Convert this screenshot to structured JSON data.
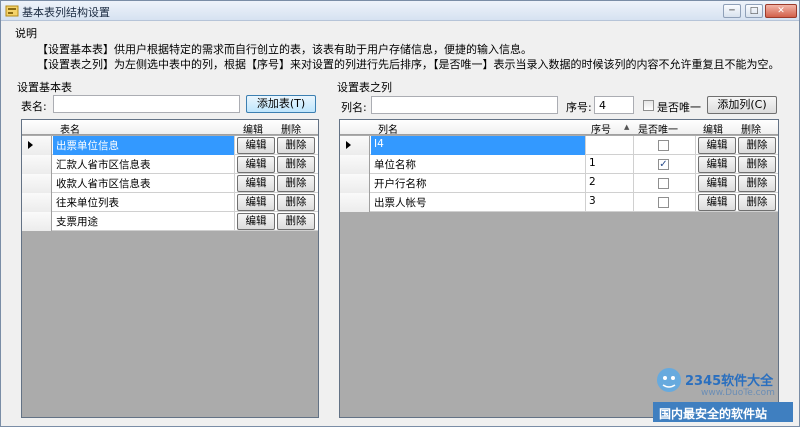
{
  "window": {
    "title": "基本表列结构设置",
    "min": "─",
    "max": "□",
    "close": "✕"
  },
  "description": {
    "heading": "说明",
    "line1": "【设置基本表】供用户根据特定的需求而自行创立的表，该表有助于用户存储信息，便捷的输入信息。",
    "line2": "【设置表之列】为左侧选中表中的列，根据【序号】来对设置的列进行先后排序，【是否唯一】表示当录入数据的时候该列的内容不允许重复且不能为空。"
  },
  "left": {
    "group_title": "设置基本表",
    "name_label": "表名:",
    "name_value": "",
    "add_button": "添加表(T)",
    "columns": {
      "name": "表名",
      "edit": "编辑",
      "delete": "删除"
    },
    "rows": [
      {
        "name": "出票单位信息",
        "edit": "编辑",
        "delete": "删除",
        "selected": true
      },
      {
        "name": "汇款人省市区信息表",
        "edit": "编辑",
        "delete": "删除",
        "selected": false
      },
      {
        "name": "收款人省市区信息表",
        "edit": "编辑",
        "delete": "删除",
        "selected": false
      },
      {
        "name": "往来单位列表",
        "edit": "编辑",
        "delete": "删除",
        "selected": false
      },
      {
        "name": "支票用途",
        "edit": "编辑",
        "delete": "删除",
        "selected": false
      }
    ]
  },
  "right": {
    "group_title": "设置表之列",
    "name_label": "列名:",
    "name_value": "",
    "order_label": "序号:",
    "order_value": "4",
    "unique_label": "是否唯一",
    "add_button": "添加列(C)",
    "columns": {
      "name": "列名",
      "order": "序号",
      "unique": "是否唯一",
      "edit": "编辑",
      "delete": "删除"
    },
    "rows": [
      {
        "name": "I4",
        "order": "",
        "unique": false,
        "edit": "编辑",
        "delete": "删除",
        "selected": true
      },
      {
        "name": "单位名称",
        "order": "1",
        "unique": true,
        "edit": "编辑",
        "delete": "删除",
        "selected": false
      },
      {
        "name": "开户行名称",
        "order": "2",
        "unique": false,
        "edit": "编辑",
        "delete": "删除",
        "selected": false
      },
      {
        "name": "出票人帐号",
        "order": "3",
        "unique": false,
        "edit": "编辑",
        "delete": "删除",
        "selected": false
      }
    ]
  },
  "watermark": {
    "brand": "2345软件大全",
    "url": "www.DuoTe.com",
    "slogan": "国内最安全的软件站"
  }
}
